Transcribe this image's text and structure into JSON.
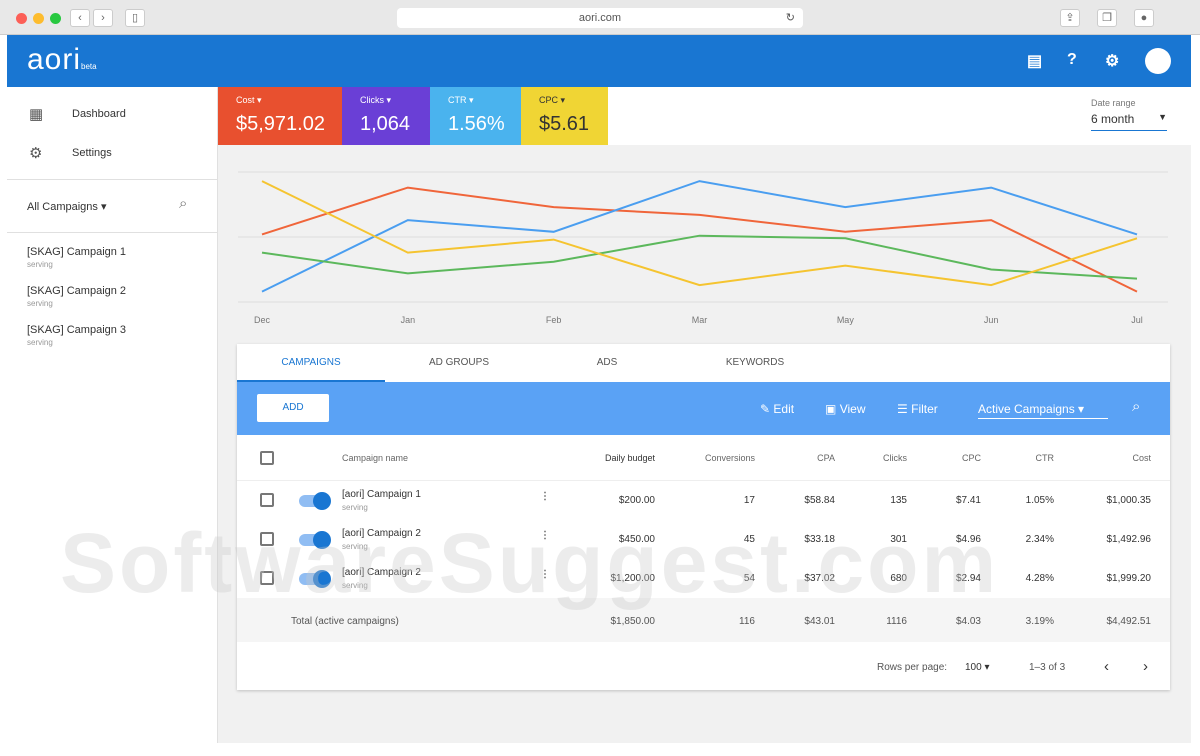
{
  "browser": {
    "url": "aori.com"
  },
  "header": {
    "logo": "aori",
    "logo_badge": "beta"
  },
  "sidebar": {
    "nav": [
      {
        "label": "Dashboard"
      },
      {
        "label": "Settings"
      }
    ],
    "filter": "All Campaigns",
    "campaigns": [
      {
        "name": "[SKAG] Campaign 1",
        "status": "serving"
      },
      {
        "name": "[SKAG] Campaign 2",
        "status": "serving"
      },
      {
        "name": "[SKAG] Campaign 3",
        "status": "serving"
      }
    ]
  },
  "metrics": [
    {
      "label": "Cost",
      "value": "$5,971.02",
      "color": "#e8502f"
    },
    {
      "label": "Clicks",
      "value": "1,064",
      "color": "#6a3fd6"
    },
    {
      "label": "CTR",
      "value": "1.56%",
      "color": "#4ab3ee"
    },
    {
      "label": "CPC",
      "value": "$5.61",
      "color": "#f0d534"
    }
  ],
  "date_range": {
    "label": "Date range",
    "value": "6 month"
  },
  "chart_data": {
    "type": "line",
    "categories": [
      "Dec",
      "Jan",
      "Feb",
      "Mar",
      "May",
      "Jun",
      "Jul"
    ],
    "ylim": [
      0,
      100
    ],
    "series": [
      {
        "name": "Cost",
        "color": "#f0653a",
        "values": [
          52,
          88,
          73,
          67,
          54,
          63,
          8
        ]
      },
      {
        "name": "CTR",
        "color": "#4a9ef0",
        "values": [
          8,
          63,
          54,
          93,
          73,
          88,
          52
        ]
      },
      {
        "name": "Clicks",
        "color": "#5cb85c",
        "values": [
          38,
          22,
          31,
          51,
          49,
          25,
          18
        ]
      },
      {
        "name": "CPC",
        "color": "#f5c430",
        "values": [
          93,
          38,
          48,
          13,
          28,
          13,
          49
        ]
      }
    ]
  },
  "tabs": [
    "CAMPAIGNS",
    "AD GROUPS",
    "ADS",
    "KEYWORDS"
  ],
  "toolbar": {
    "add": "ADD",
    "edit": "Edit",
    "view": "View",
    "filter": "Filter",
    "select": "Active Campaigns"
  },
  "table": {
    "headers": [
      "Campaign name",
      "Daily budget",
      "Conversions",
      "CPA",
      "Clicks",
      "CPC",
      "CTR",
      "Cost"
    ],
    "rows": [
      {
        "name": "[aori] Campaign 1",
        "status": "serving",
        "cells": [
          "$200.00",
          "17",
          "$58.84",
          "135",
          "$7.41",
          "1.05%",
          "$1,000.35"
        ]
      },
      {
        "name": "[aori] Campaign 2",
        "status": "serving",
        "cells": [
          "$450.00",
          "45",
          "$33.18",
          "301",
          "$4.96",
          "2.34%",
          "$1,492.96"
        ]
      },
      {
        "name": "[aori] Campaign 2",
        "status": "serving",
        "cells": [
          "$1,200.00",
          "54",
          "$37.02",
          "680",
          "$2.94",
          "4.28%",
          "$1,999.20"
        ]
      }
    ],
    "total": {
      "label": "Total (active campaigns)",
      "cells": [
        "$1,850.00",
        "116",
        "$43.01",
        "1116",
        "$4.03",
        "3.19%",
        "$4,492.51"
      ]
    }
  },
  "pagination": {
    "rows_label": "Rows per page:",
    "rows_value": "100",
    "range": "1–3 of 3"
  },
  "watermark": "SoftwareSuggest.com"
}
